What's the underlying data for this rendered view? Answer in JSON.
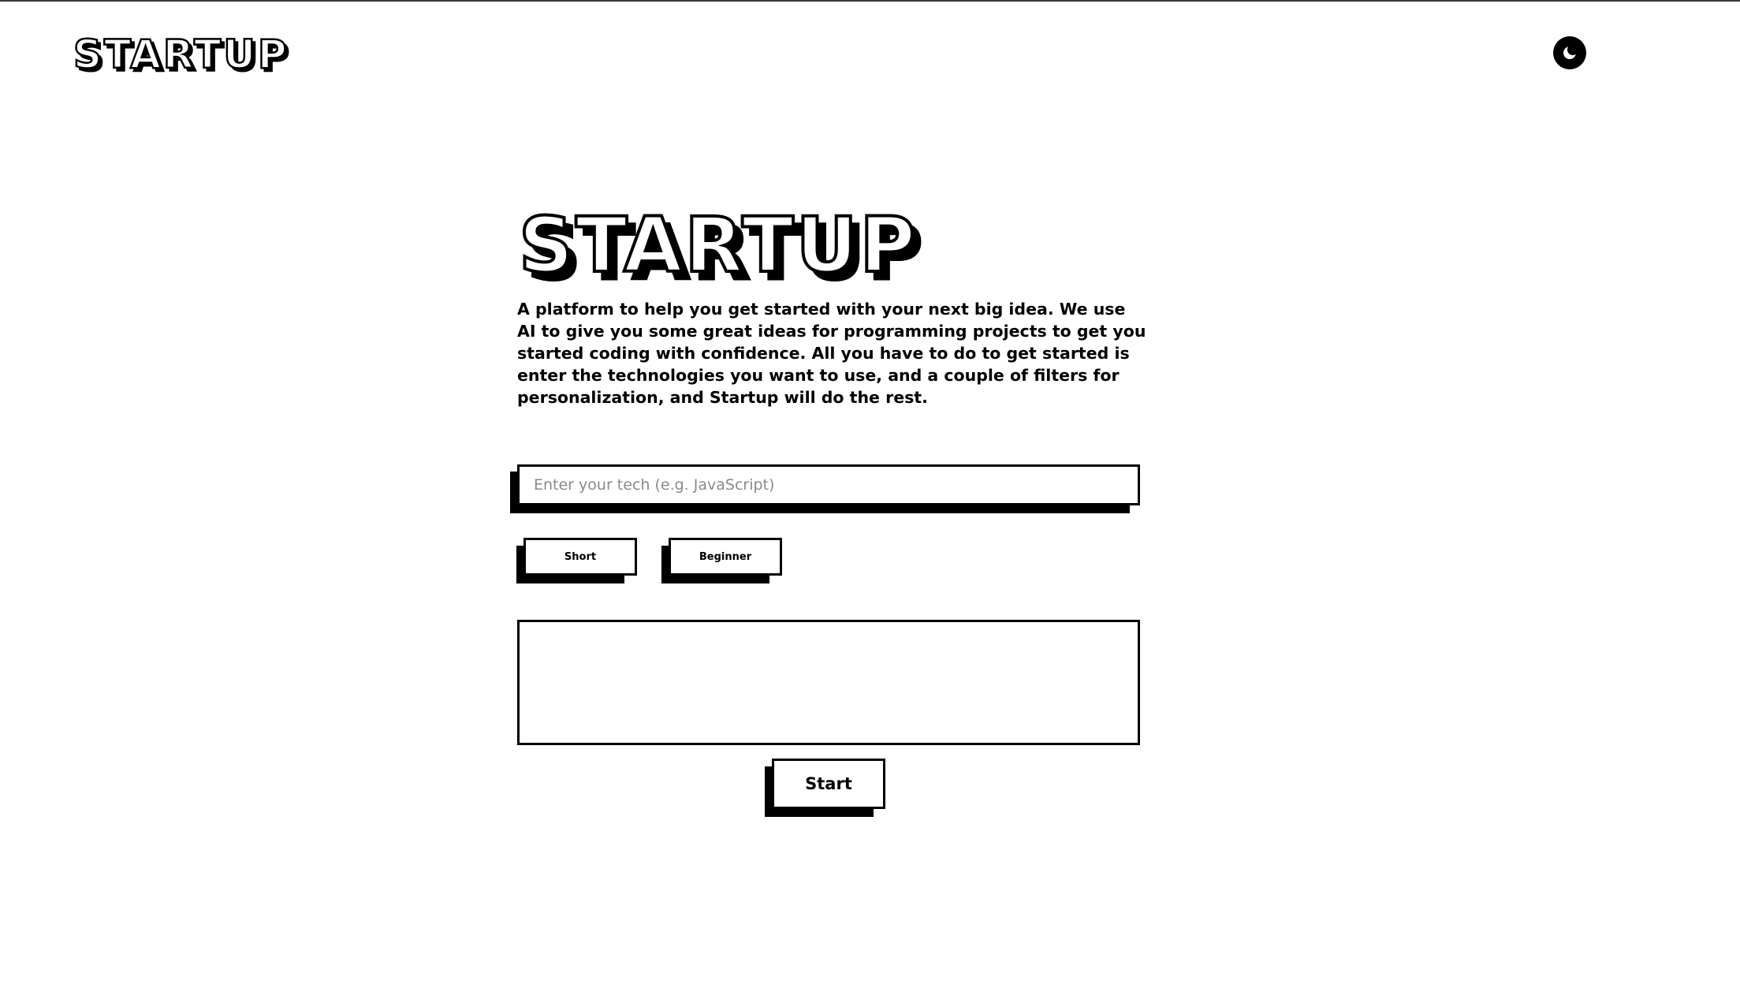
{
  "app": {
    "brand": "STARTUP"
  },
  "header": {
    "logo_text": "STARTUP",
    "theme_toggle_icon": "moon-icon"
  },
  "hero": {
    "logo_text": "STARTUP",
    "description": "A platform to help you get started with your next big idea. We use AI to give you some great ideas for programming projects to get you started coding with confidence. All you have to do to get started is enter the technologies you want to use, and a couple of filters for personalization, and Startup will do the rest."
  },
  "form": {
    "tech_input": {
      "value": "",
      "placeholder": "Enter your tech (e.g. JavaScript)"
    },
    "filters": {
      "length_label": "Short",
      "level_label": "Beginner"
    },
    "output_text": "",
    "start_label": "Start"
  },
  "colors": {
    "background": "#ffffff",
    "foreground": "#000000",
    "placeholder": "#8a8a8a"
  }
}
